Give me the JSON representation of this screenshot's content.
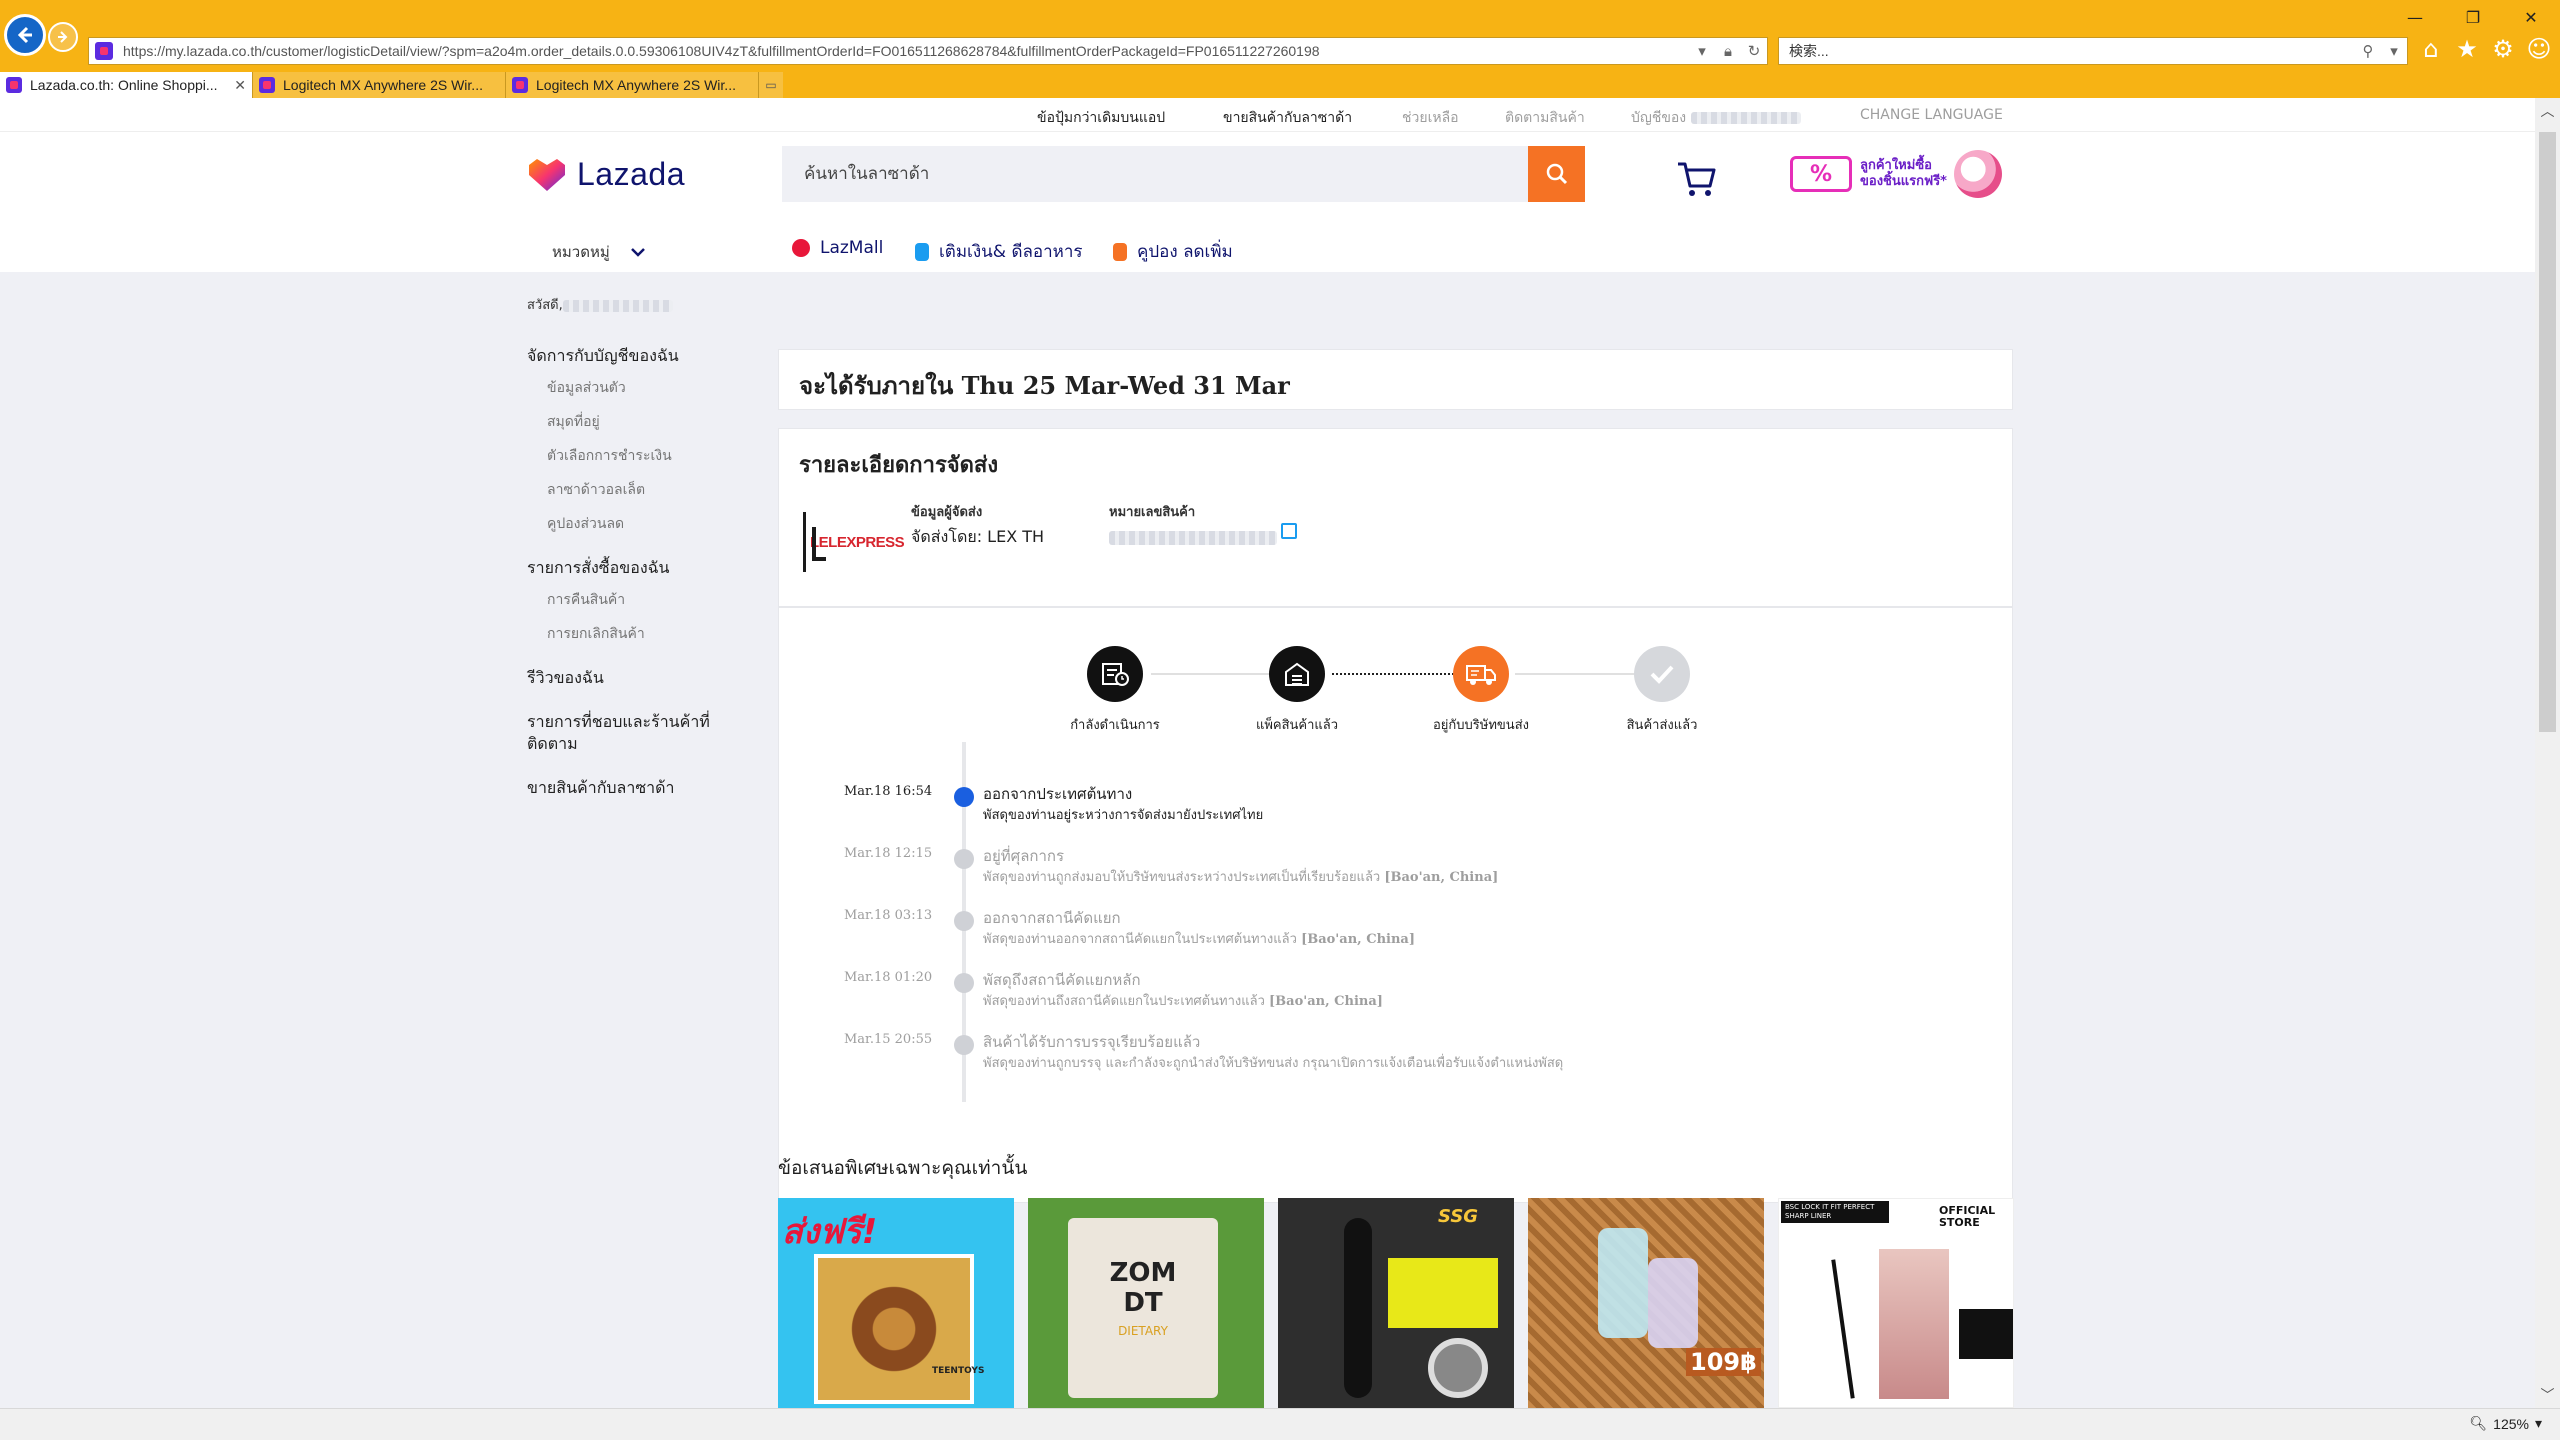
{
  "browser": {
    "url": "https://my.lazada.co.th/customer/logisticDetail/view/?spm=a2o4m.order_details.0.0.59306108UIV4zT&fulfillmentOrderId=FO016511268628784&fulfillmentOrderPackageId=FP016511227260198",
    "search_placeholder": "検索...",
    "tabs": [
      {
        "title": "Lazada.co.th: Online Shoppi...",
        "active": true
      },
      {
        "title": "Logitech MX Anywhere 2S Wir...",
        "active": false
      },
      {
        "title": "Logitech MX Anywhere 2S Wir...",
        "active": false
      }
    ],
    "zoom": "125%"
  },
  "top_links": {
    "app_deal": "ข้อปุ้มกว่าเดิมบนแอป",
    "sell": "ขายสินค้ากับลาซาด้า",
    "help": "ช่วยเหลือ",
    "track": "ติดตามสินค้า",
    "account": "บัญชีของ",
    "change_language": "CHANGE LANGUAGE"
  },
  "header": {
    "logo_text": "Lazada",
    "search_placeholder": "ค้นหาในลาซาด้า",
    "promo_text": "ลูกค้าใหม่ซื้อ ของชิ้นแรกฟรี*",
    "promo_tag": "%",
    "categories": "หมวดหมู่",
    "quick_links": [
      "LazMall",
      "เติมเงิน& ดีลอาหาร",
      "คูปอง ลดเพิ่ม"
    ]
  },
  "sidebar": {
    "greeting": "สวัสดี,",
    "groups": [
      {
        "head": "จัดการกับบัญชีของฉัน",
        "items": [
          "ข้อมูลส่วนตัว",
          "สมุดที่อยู่",
          "ตัวเลือกการชำระเงิน",
          "ลาซาด้าวอลเล็ต",
          "คูปองส่วนลด"
        ]
      },
      {
        "head": "รายการสั่งซื้อของฉัน",
        "items": [
          "การคืนสินค้า",
          "การยกเลิกสินค้า"
        ]
      },
      {
        "head": "รีวิวของฉัน",
        "items": []
      },
      {
        "head": "รายการที่ชอบและร้านค้าที่ติดตาม",
        "items": []
      },
      {
        "head": "ขายสินค้ากับลาซาด้า",
        "items": []
      }
    ]
  },
  "eta": "จะได้รับภายใน Thu 25 Mar-Wed 31 Mar",
  "details": {
    "title": "รายละเอียดการจัดส่ง",
    "carrier_logo_text": "LELEXPRESS",
    "shipper_label": "ข้อมูลผู้จัดส่ง",
    "shipper_value": "จัดส่งโดย: LEX TH",
    "tracking_label": "หมายเลขสินค้า"
  },
  "steps": [
    {
      "label": "กำลังดำเนินการ",
      "state": "done"
    },
    {
      "label": "แพ็คสินค้าแล้ว",
      "state": "done"
    },
    {
      "label": "อยู่กับบริษัทขนส่ง",
      "state": "current"
    },
    {
      "label": "สินค้าส่งแล้ว",
      "state": "pending"
    }
  ],
  "timeline": [
    {
      "time": "Mar.18 16:54",
      "title": "ออกจากประเทศต้นทาง",
      "desc": "พัสดุของท่านอยู่ระหว่างการจัดส่งมายังประเทศไทย",
      "loc": "",
      "current": true
    },
    {
      "time": "Mar.18 12:15",
      "title": "อยู่ที่ศุลกากร",
      "desc": "พัสดุของท่านถูกส่งมอบให้บริษัทขนส่งระหว่างประเทศเป็นที่เรียบร้อยแล้ว",
      "loc": "[Bao'an, China]",
      "current": false
    },
    {
      "time": "Mar.18 03:13",
      "title": "ออกจากสถานีคัดแยก",
      "desc": "พัสดุของท่านออกจากสถานีคัดแยกในประเทศต้นทางแล้ว",
      "loc": "[Bao'an, China]",
      "current": false
    },
    {
      "time": "Mar.18 01:20",
      "title": "พัสดุถึงสถานีคัดแยกหลัก",
      "desc": "พัสดุของท่านถึงสถานีคัดแยกในประเทศต้นทางแล้ว",
      "loc": "[Bao'an, China]",
      "current": false
    },
    {
      "time": "Mar.15 20:55",
      "title": "สินค้าได้รับการบรรจุเรียบร้อยแล้ว",
      "desc": "พัสดุของท่านถูกบรรจุ และกำลังจะถูกนำส่งให้บริษัทขนส่ง กรุณาเปิดการแจ้งเตือนเพื่อรับแจ้งตำแหน่งพัสดุ",
      "loc": "",
      "current": false
    }
  ],
  "offers": {
    "title": "ข้อเสนอพิเศษเฉพาะคุณเท่านั้น",
    "products": [
      {
        "name": "mixed-candy-pack",
        "badge": "ส่งฟรี!",
        "sub": "TEENTOYS"
      },
      {
        "name": "zom-dt-dietary",
        "badge": "ZOM DT",
        "sub": "DIETARY"
      },
      {
        "name": "ssg-skateboard",
        "badge": "SSG",
        "sub": ""
      },
      {
        "name": "hand-gel-bottles",
        "badge": "109฿",
        "sub": ""
      },
      {
        "name": "bsc-eyeliner",
        "badge": "OFFICIAL STORE",
        "sub": "BSC LOCK IT FIT PERFECT SHARP LINER"
      }
    ]
  }
}
